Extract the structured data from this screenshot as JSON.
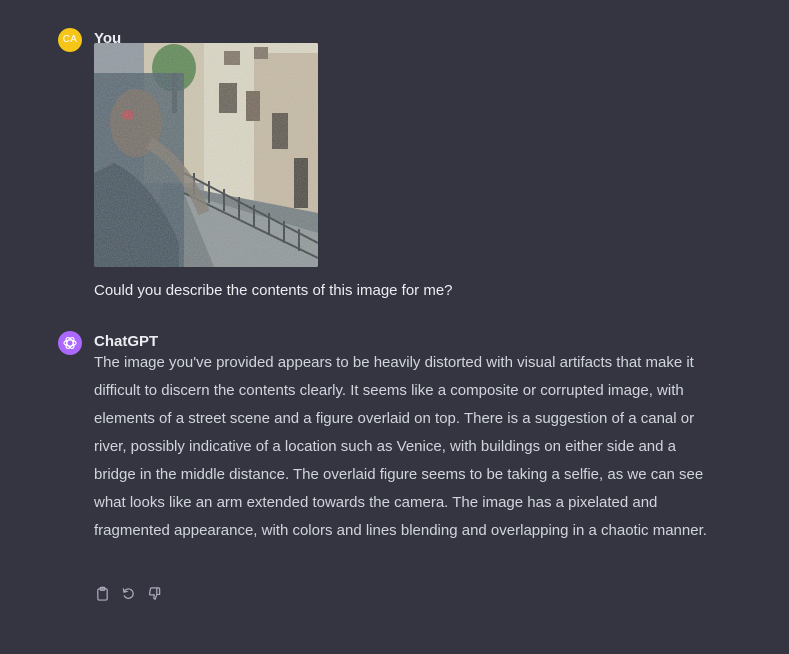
{
  "colors": {
    "background": "#343541",
    "user_avatar": "#f5c518",
    "assistant_avatar": "#ab68ff",
    "text": "#ececf1",
    "reply_text": "#d1d5db",
    "icon": "#acacbe"
  },
  "user_message": {
    "avatar_initials": "CA",
    "author": "You",
    "text": "Could you describe the contents of this image for me?"
  },
  "assistant_message": {
    "author": "ChatGPT",
    "text": "The image you've provided appears to be heavily distorted with visual artifacts that make it difficult to discern the contents clearly. It seems like a composite or corrupted image, with elements of a street scene and a figure overlaid on top. There is a suggestion of a canal or river, possibly indicative of a location such as Venice, with buildings on either side and a bridge in the middle distance. The overlaid figure seems to be taking a selfie, as we can see what looks like an arm extended towards the camera. The image has a pixelated and fragmented appearance, with colors and lines blending and overlapping in a chaotic manner.",
    "actions": [
      "clipboard-icon",
      "regenerate-icon",
      "thumbs-down-icon"
    ]
  }
}
